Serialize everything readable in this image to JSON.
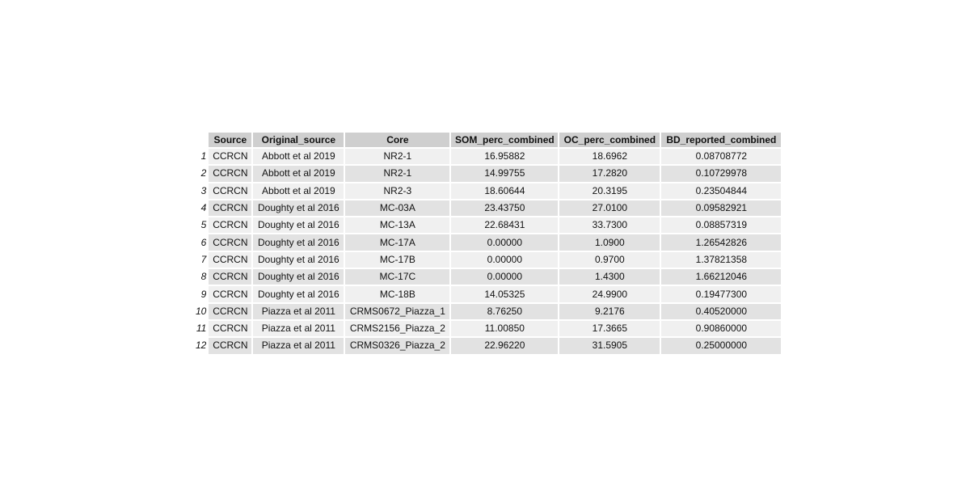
{
  "table": {
    "columns": [
      "Source",
      "Original_source",
      "Core",
      "SOM_perc_combined",
      "OC_perc_combined",
      "BD_reported_combined"
    ],
    "rows": [
      [
        "1",
        "CCRCN",
        "Abbott et al 2019",
        "NR2-1",
        "16.95882",
        "18.6962",
        "0.08708772"
      ],
      [
        "2",
        "CCRCN",
        "Abbott et al 2019",
        "NR2-1",
        "14.99755",
        "17.2820",
        "0.10729978"
      ],
      [
        "3",
        "CCRCN",
        "Abbott et al 2019",
        "NR2-3",
        "18.60644",
        "20.3195",
        "0.23504844"
      ],
      [
        "4",
        "CCRCN",
        "Doughty et al 2016",
        "MC-03A",
        "23.43750",
        "27.0100",
        "0.09582921"
      ],
      [
        "5",
        "CCRCN",
        "Doughty et al 2016",
        "MC-13A",
        "22.68431",
        "33.7300",
        "0.08857319"
      ],
      [
        "6",
        "CCRCN",
        "Doughty et al 2016",
        "MC-17A",
        "0.00000",
        "1.0900",
        "1.26542826"
      ],
      [
        "7",
        "CCRCN",
        "Doughty et al 2016",
        "MC-17B",
        "0.00000",
        "0.9700",
        "1.37821358"
      ],
      [
        "8",
        "CCRCN",
        "Doughty et al 2016",
        "MC-17C",
        "0.00000",
        "1.4300",
        "1.66212046"
      ],
      [
        "9",
        "CCRCN",
        "Doughty et al 2016",
        "MC-18B",
        "14.05325",
        "24.9900",
        "0.19477300"
      ],
      [
        "10",
        "CCRCN",
        "Piazza et al 2011",
        "CRMS0672_Piazza_1",
        "8.76250",
        "9.2176",
        "0.40520000"
      ],
      [
        "11",
        "CCRCN",
        "Piazza et al 2011",
        "CRMS2156_Piazza_2",
        "11.00850",
        "17.3665",
        "0.90860000"
      ],
      [
        "12",
        "CCRCN",
        "Piazza et al 2011",
        "CRMS0326_Piazza_2",
        "22.96220",
        "31.5905",
        "0.25000000"
      ]
    ]
  }
}
